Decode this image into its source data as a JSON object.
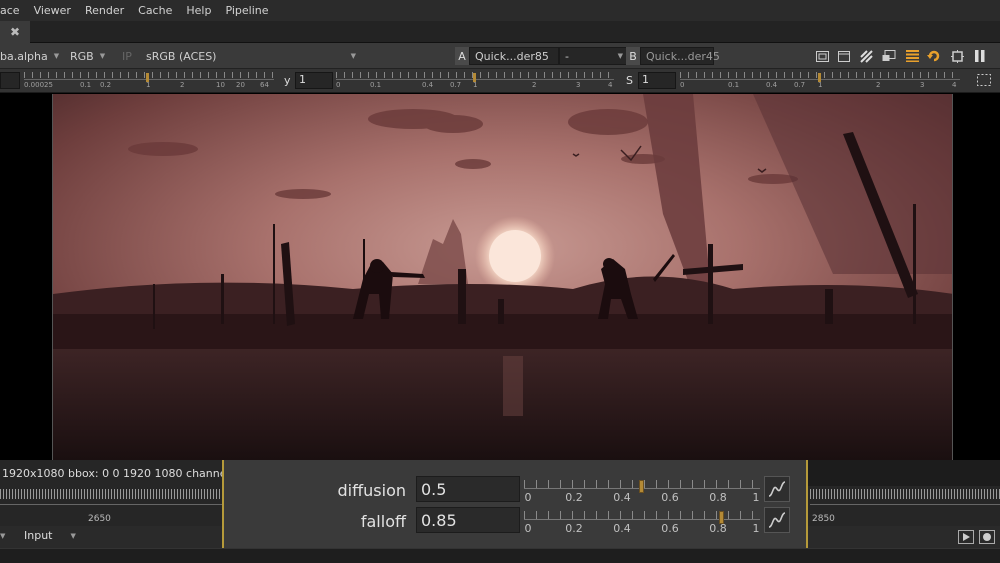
{
  "menu": [
    "ace",
    "Viewer",
    "Render",
    "Cache",
    "Help",
    "Pipeline"
  ],
  "tab": {
    "close_glyph": "✖"
  },
  "toolbar": {
    "channel": "ba.alpha",
    "rgb": "RGB",
    "ip": "IP",
    "colorspace": "sRGB (ACES)",
    "a_label": "A",
    "a_input": "Quick...der85",
    "a_dash": "-",
    "b_label": "B",
    "b_input": "Quick...der45",
    "icons": [
      "roi-icon",
      "safe-area-icon",
      "wipe-icon",
      "proxy-icon",
      "lut-icon",
      "refresh-icon",
      "pause-icon"
    ]
  },
  "gain_row": {
    "y_label": "y",
    "y_value": "1",
    "s_label": "S",
    "s_value": "1",
    "left_ticks": [
      "0.00025",
      "0.1",
      "0.2",
      "1",
      "2",
      "10",
      "20",
      "64"
    ],
    "mid_ticks": [
      "0",
      "0.1",
      "0.4",
      "0.7",
      "1",
      "2",
      "3",
      "4"
    ],
    "right_ticks": [
      "0",
      "0.1",
      "0.4",
      "0.7",
      "1",
      "2",
      "3",
      "4"
    ]
  },
  "info": {
    "text": "1920x1080  bbox: 0 0 1920 1080 channe"
  },
  "timeline": {
    "left_frame": "2650",
    "right_frame": "2850",
    "input_mode": "Input"
  },
  "properties": {
    "diffusion": {
      "label": "diffusion",
      "value": "0.5",
      "level": 0.5
    },
    "falloff": {
      "label": "falloff",
      "value": "0.85",
      "level": 0.85
    },
    "slider_ticks": [
      "0",
      "0.2",
      "0.4",
      "0.6",
      "0.8",
      "1"
    ]
  },
  "colors": {
    "accent": "#e8a02c",
    "knob": "#b48a36",
    "border": "#b59a3a"
  }
}
